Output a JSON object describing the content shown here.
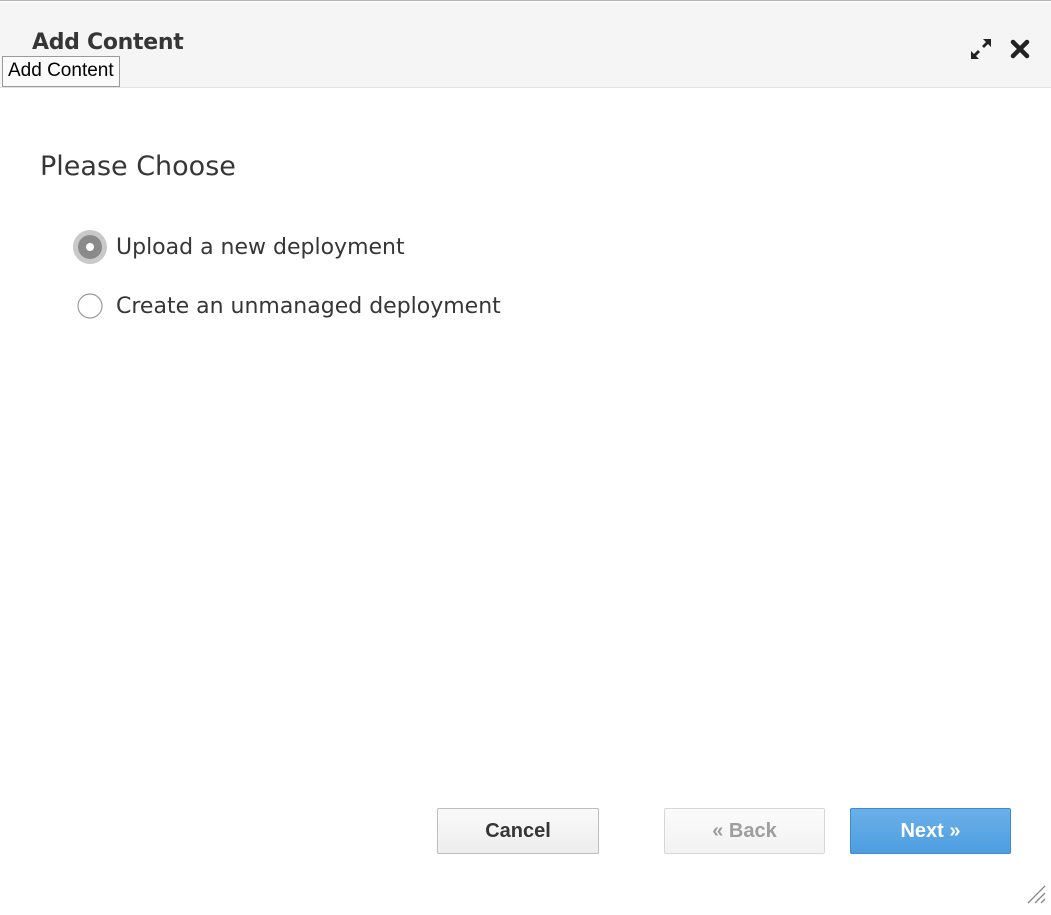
{
  "dialog": {
    "title": "Add Content",
    "tooltip": "Add Content",
    "icons": {
      "maximize": "maximize-icon",
      "close": "close-icon",
      "resize": "resize-grip-icon"
    }
  },
  "main": {
    "heading": "Please Choose",
    "options": [
      {
        "label": "Upload a new deployment",
        "selected": true
      },
      {
        "label": "Create an unmanaged deployment",
        "selected": false
      }
    ]
  },
  "footer": {
    "cancel_label": "Cancel",
    "back_label": "« Back",
    "next_label": "Next »"
  },
  "colors": {
    "primary": "#4d9ee0",
    "text": "#363636",
    "disabled_text": "#9e9e9e",
    "header_bg": "#f5f5f5"
  }
}
